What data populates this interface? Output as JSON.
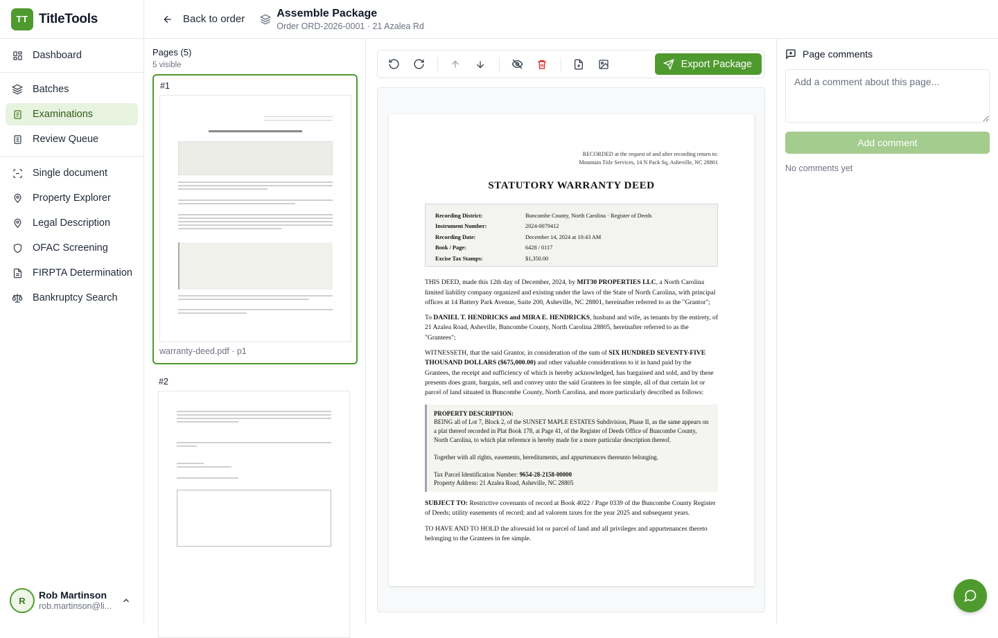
{
  "app": {
    "logo_initials": "TT",
    "name": "TitleTools"
  },
  "sidebar": {
    "items": [
      {
        "label": "Dashboard",
        "icon": "dashboard-icon"
      },
      {
        "label": "Batches",
        "icon": "layers-icon"
      },
      {
        "label": "Examinations",
        "icon": "clipboard-icon",
        "active": true
      },
      {
        "label": "Review Queue",
        "icon": "clipboard-list-icon"
      },
      {
        "label": "Single document",
        "icon": "scan-icon"
      },
      {
        "label": "Property Explorer",
        "icon": "map-pin-icon"
      },
      {
        "label": "Legal Description",
        "icon": "map-pin-icon"
      },
      {
        "label": "OFAC Screening",
        "icon": "shield-icon"
      },
      {
        "label": "FIRPTA Determination",
        "icon": "document-icon"
      },
      {
        "label": "Bankruptcy Search",
        "icon": "scale-icon"
      }
    ]
  },
  "user": {
    "initial": "R",
    "name": "Rob Martinson",
    "email": "rob.martinson@li..."
  },
  "header": {
    "back_label": "Back to order",
    "title": "Assemble Package",
    "subtitle": "Order ORD-2026-0001 · 21 Azalea Rd"
  },
  "pages_panel": {
    "title": "Pages (5)",
    "subtitle": "5 visible",
    "pages": [
      {
        "number": "#1",
        "file": "warranty-deed.pdf · p1"
      },
      {
        "number": "#2",
        "file": ""
      }
    ]
  },
  "toolbar": {
    "export_label": "Export Package"
  },
  "document": {
    "recorded_line1": "RECORDED at the request of and after recording return to:",
    "recorded_line2": "Mountain Title Services, 14 N Pack Sq, Asheville, NC 28801",
    "title": "STATUTORY WARRANTY DEED",
    "recording": [
      {
        "key": "Recording District:",
        "value": "Buncombe County, North Carolina · Register of Deeds"
      },
      {
        "key": "Instrument Number:",
        "value": "2024-0079412"
      },
      {
        "key": "Recording Date:",
        "value": "December 14, 2024 at 10:43 AM"
      },
      {
        "key": "Book / Page:",
        "value": "6428 / 0117"
      },
      {
        "key": "Excise Tax Stamps:",
        "value": "$1,350.00"
      }
    ],
    "p1_a": "THIS DEED, made this 12th day of December, 2024, by ",
    "p1_b": "MIT30 PROPERTIES LLC",
    "p1_c": ", a North Carolina limited liability company organized and existing under the laws of the State of North Carolina, with principal offices at 14 Battery Park Avenue, Suite 200, Asheville, NC 28801, hereinafter referred to as the \"Grantor\";",
    "p2_a": "To ",
    "p2_b": "DANIEL T. HENDRICKS and MIRA E. HENDRICKS",
    "p2_c": ", husband and wife, as tenants by the entirety, of 21 Azalea Road, Asheville, Buncombe County, North Carolina 28805, hereinafter referred to as the \"Grantees\";",
    "p3_a": "WITNESSETH, that the said Grantor, in consideration of the sum of ",
    "p3_b": "SIX HUNDRED SEVENTY-FIVE THOUSAND DOLLARS ($675,000.00)",
    "p3_c": " and other valuable considerations to it in hand paid by the Grantees, the receipt and sufficiency of which is hereby acknowledged, has bargained and sold, and by these presents does grant, bargain, sell and convey unto the said Grantees in fee simple, all of that certain lot or parcel of land situated in Buncombe County, North Carolina, and more particularly described as follows:",
    "prop_heading": "PROPERTY DESCRIPTION:",
    "prop_text": "BEING all of Lot 7, Block 2, of the SUNSET MAPLE ESTATES Subdivision, Phase II, as the same appears on a plat thereof recorded in Plat Book 178, at Page 41, of the Register of Deeds Office of Buncombe County, North Carolina, to which plat reference is hereby made for a more particular description thereof.",
    "prop_together": "Together with all rights, easements, hereditaments, and appurtenances thereunto belonging.",
    "prop_tax_label": "Tax Parcel Identification Number: ",
    "prop_tax_value": "9654-28-2158-00000",
    "prop_address": "Property Address: 21 Azalea Road, Asheville, NC 28805",
    "p4_a": "SUBJECT TO:",
    "p4_b": " Restrictive covenants of record at Book 4022 / Page 0339 of the Buncombe County Register of Deeds; utility easements of record; and ad valorem taxes for the year 2025 and subsequent years.",
    "p5": "TO HAVE AND TO HOLD the aforesaid lot or parcel of land and all privileges and appurtenances thereto belonging to the Grantees in fee simple."
  },
  "comments": {
    "title": "Page comments",
    "placeholder": "Add a comment about this page...",
    "button": "Add comment",
    "empty": "No comments yet"
  },
  "colors": {
    "brand": "#4f9a2e",
    "active_bg": "#e8f3df",
    "delete": "#dc2626",
    "disabled_button": "#a4cc8e"
  }
}
